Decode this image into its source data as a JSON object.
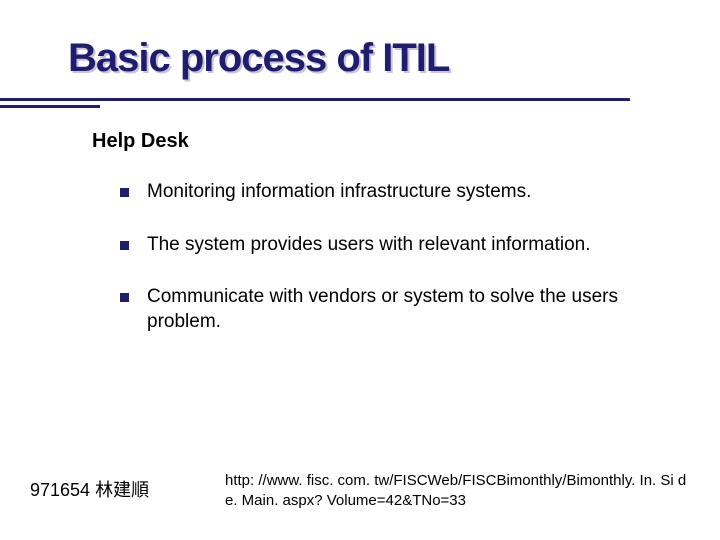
{
  "title": "Basic process of ITIL",
  "subtitle": "Help Desk",
  "bullets": [
    "Monitoring information infrastructure systems.",
    "The system provides users with relevant information.",
    "Communicate with vendors or system to solve the users problem."
  ],
  "footer": {
    "left": "971654 林建順",
    "right": "http: //www. fisc. com. tw/FISCWeb/FISCBimonthly/Bimonthly. In. Si de. Main. aspx? Volume=42&TNo=33"
  }
}
